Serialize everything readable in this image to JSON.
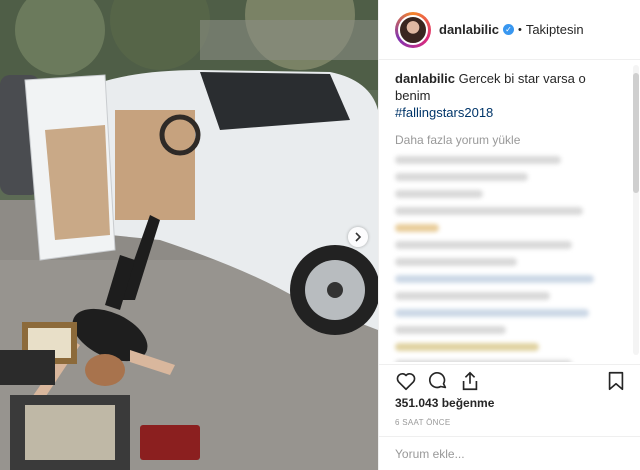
{
  "post": {
    "username": "danlabilic",
    "follow_status": "Takiptesin",
    "caption_user": "danlabilic",
    "caption_text": "Gercek bi star varsa o benim",
    "caption_hashtag": "#fallingstars2018",
    "load_more_comments": "Daha fazla yorum yükle",
    "likes": "351.043 beğenme",
    "time_ago": "6 SAAT ÖNCE",
    "comment_placeholder": "Yorum ekle..."
  },
  "icons": {
    "verified": "verified-badge-icon",
    "like": "heart-icon",
    "comment": "comment-bubble-icon",
    "share": "share-icon",
    "save": "bookmark-icon",
    "next": "chevron-right-icon"
  },
  "colors": {
    "verified": "#3897f0",
    "hashtag": "#003569",
    "text": "#262626",
    "muted": "#999999"
  }
}
